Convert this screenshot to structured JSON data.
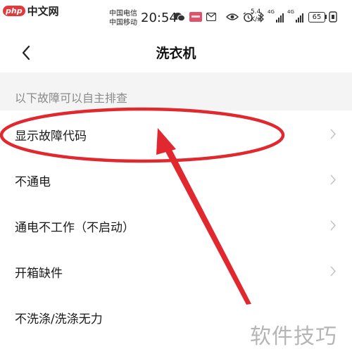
{
  "status_bar": {
    "watermark_badge": "php",
    "watermark_text": "中文网",
    "carrier_1": "中国电信",
    "carrier_2": "中国移动",
    "time": "20:54",
    "net_speed_value": "5.4",
    "net_speed_unit": "K/s",
    "signal_1_tag": "4G",
    "signal_2_tag": "4G",
    "battery": "65"
  },
  "header": {
    "title": "洗衣机"
  },
  "section": {
    "title": "以下故障可以自主排查"
  },
  "items": [
    {
      "label": "显示故障代码"
    },
    {
      "label": "不通电"
    },
    {
      "label": "通电不工作（不启动）"
    },
    {
      "label": "开箱缺件"
    },
    {
      "label": "不洗涤/洗涤无力"
    }
  ],
  "watermark_footer": "软件技巧",
  "colors": {
    "annotation": "#e0282e",
    "section_bg": "#f4f4f4",
    "chevron": "#c4c4c4"
  }
}
